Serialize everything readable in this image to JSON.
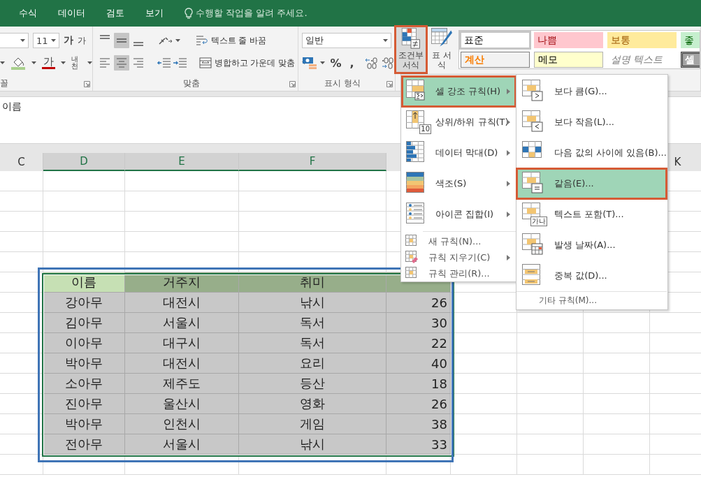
{
  "ribbon_tabs": [
    {
      "label": "수식",
      "selected": false
    },
    {
      "label": "데이터",
      "selected": false
    },
    {
      "label": "검토",
      "selected": false
    },
    {
      "label": "보기",
      "selected": false
    }
  ],
  "tell_me": {
    "placeholder": "수행할 작업을 알려 주세요."
  },
  "font_group": {
    "label": "꼴",
    "font_size": "11",
    "grow_glyph": "가",
    "shrink_glyph": "가",
    "font_color_glyph": "가",
    "phonetic_glyph": "내천"
  },
  "alignment_group": {
    "label": "맞춤",
    "wrap_text": "텍스트 줄 바꿈",
    "merge_center": "병합하고 가운데 맞춤",
    "vertical_align": [
      {
        "kind": "top",
        "selected": false
      },
      {
        "kind": "middle",
        "selected": true
      },
      {
        "kind": "bottom",
        "selected": false
      }
    ],
    "horizontal_align": [
      {
        "kind": "left",
        "selected": false
      },
      {
        "kind": "center",
        "selected": true
      },
      {
        "kind": "right",
        "selected": false
      }
    ]
  },
  "number_group": {
    "label": "표시 형식",
    "format": "일반",
    "percent": "%",
    "comma": ","
  },
  "styles_group": {
    "conditional_formatting": {
      "label": "조건부 서식",
      "highlighted": true
    },
    "format_as_table": {
      "label": "표 서식"
    },
    "cell_styles": [
      {
        "label": "표준",
        "kind": "normal",
        "selected": true
      },
      {
        "label": "나쁨",
        "kind": "bad",
        "selected": false
      },
      {
        "label": "보통",
        "kind": "neutral",
        "selected": false
      },
      {
        "label": "좋",
        "kind": "good",
        "selected": false
      },
      {
        "label": "계산",
        "kind": "calculation",
        "selected": false
      },
      {
        "label": "메모",
        "kind": "note",
        "selected": false
      },
      {
        "label": "설명 텍스트",
        "kind": "explanatory",
        "selected": false
      },
      {
        "label": "셀",
        "kind": "check",
        "selected": false
      }
    ]
  },
  "formula_bar": {
    "value": "이름"
  },
  "column_headers": [
    {
      "label": "C",
      "selected": false
    },
    {
      "label": "D",
      "selected": true
    },
    {
      "label": "E",
      "selected": true
    },
    {
      "label": "F",
      "selected": true
    },
    {
      "label": "K",
      "selected": false
    }
  ],
  "table": {
    "highlighted": true,
    "columns": [
      {
        "label": "이름",
        "active": true
      },
      {
        "label": "거주지",
        "active": false
      },
      {
        "label": "취미",
        "active": false
      },
      {
        "active": false
      }
    ],
    "rows": [
      [
        "강아무",
        "대전시",
        "낚시",
        "26"
      ],
      [
        "김아무",
        "서울시",
        "독서",
        "30"
      ],
      [
        "이아무",
        "대구시",
        "독서",
        "22"
      ],
      [
        "박아무",
        "대전시",
        "요리",
        "40"
      ],
      [
        "소아무",
        "제주도",
        "등산",
        "18"
      ],
      [
        "진아무",
        "울산시",
        "영화",
        "26"
      ],
      [
        "박아무",
        "인천시",
        "게임",
        "38"
      ],
      [
        "전아무",
        "서울시",
        "낚시",
        "33"
      ]
    ]
  },
  "menu": {
    "items": [
      {
        "label": "셀 강조 규칙(H)",
        "kind": "large",
        "selected": true,
        "highlighted": true,
        "submenu": true
      },
      {
        "label": "상위/하위 규칙(T)",
        "kind": "large",
        "selected": false,
        "highlighted": false,
        "submenu": true,
        "badge": "10"
      },
      {
        "label": "데이터 막대(D)",
        "kind": "large",
        "selected": false,
        "highlighted": false,
        "submenu": true
      },
      {
        "label": "색조(S)",
        "kind": "large",
        "selected": false,
        "highlighted": false,
        "submenu": true
      },
      {
        "label": "아이콘 집합(I)",
        "kind": "large",
        "selected": false,
        "highlighted": false,
        "submenu": true
      },
      {
        "label": "새 규칙(N)...",
        "kind": "small",
        "selected": false,
        "highlighted": false,
        "submenu": false
      },
      {
        "label": "규칙 지우기(C)",
        "kind": "small",
        "selected": false,
        "highlighted": false,
        "submenu": true
      },
      {
        "label": "규칙 관리(R)...",
        "kind": "small",
        "selected": false,
        "highlighted": false,
        "submenu": false
      }
    ]
  },
  "submenu": {
    "items": [
      {
        "label": "보다 큼(G)...",
        "selected": false,
        "highlighted": false
      },
      {
        "label": "보다 작음(L)...",
        "selected": false,
        "highlighted": false
      },
      {
        "label": "다음 값의 사이에 있음(B)...",
        "selected": false,
        "highlighted": false
      },
      {
        "label": "같음(E)...",
        "selected": true,
        "highlighted": true
      },
      {
        "label": "텍스트 포함(T)...",
        "selected": false,
        "highlighted": false,
        "badge": "가나"
      },
      {
        "label": "발생 날짜(A)...",
        "selected": false,
        "highlighted": false
      },
      {
        "label": "중복 값(D)...",
        "selected": false,
        "highlighted": false
      }
    ],
    "footer": "기타 규칙(M)..."
  }
}
